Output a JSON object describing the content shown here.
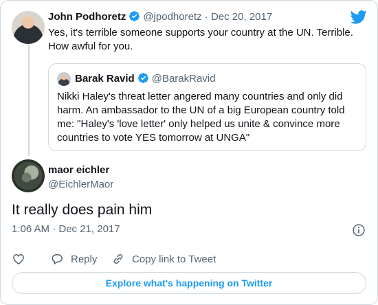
{
  "parent_tweet": {
    "author_name": "John Podhoretz",
    "author_handle": "@jpodhoretz",
    "separator": "·",
    "date": "Dec 20, 2017",
    "text": "Yes, it's terrible someone supports your country at the UN. Terrible. How awful for you."
  },
  "quoted_tweet": {
    "author_name": "Barak Ravid",
    "author_handle": "@BarakRavid",
    "text": "Nikki Haley's threat letter angered many countries and only did harm. An ambassador to the UN of a big European country told me: \"Haley's 'love letter' only helped us unite & convince more countries to vote YES tomorrow at UNGA\""
  },
  "main_tweet": {
    "author_name": "maor eichler",
    "author_handle": "@EichlerMaor",
    "text": "It really does pain him",
    "timestamp": "1:06 AM · Dec 21, 2017"
  },
  "actions": {
    "reply_label": "Reply",
    "copy_link_label": "Copy link to Tweet"
  },
  "footer": {
    "explore_label": "Explore what's happening on Twitter"
  },
  "icons": {
    "verified": "verified-badge-icon",
    "brand": "twitter-bird-icon",
    "info": "info-icon",
    "like": "heart-icon",
    "reply": "speech-bubble-icon",
    "copy_link": "link-icon"
  },
  "colors": {
    "brand_blue": "#1d9bf0",
    "text_primary": "#0f1419",
    "text_secondary": "#536471",
    "border": "#cfd9de"
  }
}
